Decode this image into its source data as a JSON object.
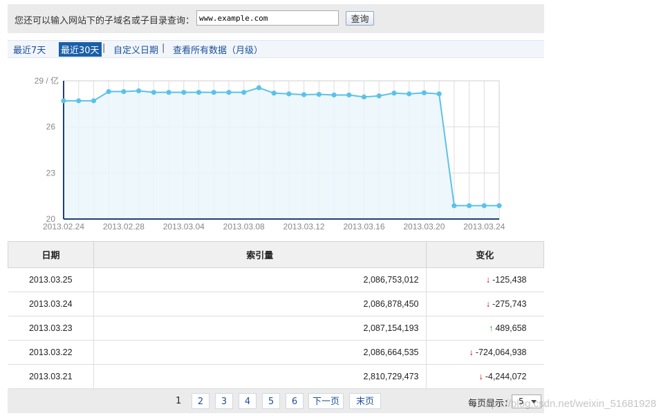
{
  "query": {
    "label": "您还可以输入网站下的子域名或子目录查询：",
    "input_value": "www.example.com",
    "button_label": "查询"
  },
  "range_tabs": {
    "items": [
      "最近7天",
      "最近30天",
      "自定义日期",
      "查看所有数据（月级）"
    ],
    "active": "最近30天",
    "separator": "|"
  },
  "chart_data": {
    "type": "area",
    "y_unit_label": "29 / 亿",
    "y_ticks": [
      "26",
      "23",
      "20"
    ],
    "ylim": [
      20,
      29
    ],
    "x_tick_labels": [
      "2013.02.24",
      "2013.02.28",
      "2013.03.04",
      "2013.03.08",
      "2013.03.12",
      "2013.03.16",
      "2013.03.20",
      "2013.03.24"
    ],
    "x": [
      "2013.02.24",
      "2013.02.25",
      "2013.02.26",
      "2013.02.27",
      "2013.02.28",
      "2013.03.01",
      "2013.03.02",
      "2013.03.03",
      "2013.03.04",
      "2013.03.05",
      "2013.03.06",
      "2013.03.07",
      "2013.03.08",
      "2013.03.09",
      "2013.03.10",
      "2013.03.11",
      "2013.03.12",
      "2013.03.13",
      "2013.03.14",
      "2013.03.15",
      "2013.03.16",
      "2013.03.17",
      "2013.03.18",
      "2013.03.19",
      "2013.03.20",
      "2013.03.21",
      "2013.03.22",
      "2013.03.23",
      "2013.03.24",
      "2013.03.25"
    ],
    "values": [
      27.7,
      27.7,
      27.7,
      28.3,
      28.3,
      28.35,
      28.25,
      28.25,
      28.25,
      28.25,
      28.25,
      28.25,
      28.25,
      28.55,
      28.2,
      28.15,
      28.1,
      28.12,
      28.08,
      28.08,
      27.95,
      28.02,
      28.2,
      28.15,
      28.22,
      28.15,
      20.87,
      20.87,
      20.87,
      20.87
    ],
    "grid": true,
    "line_color": "#5bc2e7",
    "fill_color": "#eaf6fc"
  },
  "table": {
    "headers": [
      "日期",
      "索引量",
      "变化"
    ],
    "rows": [
      {
        "date": "2013.03.25",
        "index": "2,086,753,012",
        "dir": "down",
        "change": "-125,438"
      },
      {
        "date": "2013.03.24",
        "index": "2,086,878,450",
        "dir": "down",
        "change": "-275,743"
      },
      {
        "date": "2013.03.23",
        "index": "2,087,154,193",
        "dir": "up",
        "change": "489,658"
      },
      {
        "date": "2013.03.22",
        "index": "2,086,664,535",
        "dir": "down",
        "change": "-724,064,938"
      },
      {
        "date": "2013.03.21",
        "index": "2,810,729,473",
        "dir": "down",
        "change": "-4,244,072"
      }
    ]
  },
  "pagination": {
    "current": "1",
    "pages": [
      "2",
      "3",
      "4",
      "5",
      "6"
    ],
    "next_label": "下一页",
    "last_label": "末页",
    "per_page_label": "每页显示：",
    "per_page_value": "5"
  },
  "watermark": "https://blog.csdn.net/weixin_51681928"
}
